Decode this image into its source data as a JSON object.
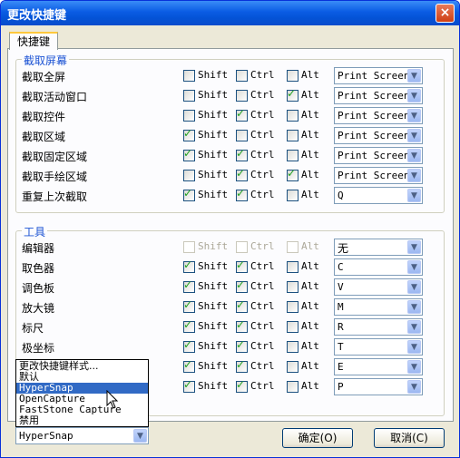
{
  "window": {
    "title": "更改快捷键",
    "close_glyph": "×"
  },
  "tab": {
    "label": "快捷键"
  },
  "capture_group": {
    "title": "截取屏幕",
    "rows": [
      {
        "label": "截取全屏",
        "shift": "Shift",
        "ctrl": "Ctrl",
        "alt": "Alt",
        "shift_checked": false,
        "ctrl_checked": false,
        "alt_checked": false,
        "value": "Print Screen"
      },
      {
        "label": "截取活动窗口",
        "shift": "Shift",
        "ctrl": "Ctrl",
        "alt": "Alt",
        "shift_checked": false,
        "ctrl_checked": false,
        "alt_checked": true,
        "value": "Print Screen"
      },
      {
        "label": "截取控件",
        "shift": "Shift",
        "ctrl": "Ctrl",
        "alt": "Alt",
        "shift_checked": false,
        "ctrl_checked": true,
        "alt_checked": false,
        "value": "Print Screen"
      },
      {
        "label": "截取区域",
        "shift": "Shift",
        "ctrl": "Ctrl",
        "alt": "Alt",
        "shift_checked": true,
        "ctrl_checked": false,
        "alt_checked": false,
        "value": "Print Screen"
      },
      {
        "label": "截取固定区域",
        "shift": "Shift",
        "ctrl": "Ctrl",
        "alt": "Alt",
        "shift_checked": true,
        "ctrl_checked": true,
        "alt_checked": false,
        "value": "Print Screen"
      },
      {
        "label": "截取手绘区域",
        "shift": "Shift",
        "ctrl": "Ctrl",
        "alt": "Alt",
        "shift_checked": false,
        "ctrl_checked": true,
        "alt_checked": true,
        "value": "Print Screen"
      },
      {
        "label": "重复上次截取",
        "shift": "Shift",
        "ctrl": "Ctrl",
        "alt": "Alt",
        "shift_checked": true,
        "ctrl_checked": true,
        "alt_checked": false,
        "value": "Q"
      }
    ]
  },
  "tools_group": {
    "title": "工具",
    "rows": [
      {
        "label": "编辑器",
        "shift": "Shift",
        "ctrl": "Ctrl",
        "alt": "Alt",
        "shift_checked": false,
        "ctrl_checked": false,
        "alt_checked": false,
        "disabled": true,
        "value": "无"
      },
      {
        "label": "取色器",
        "shift": "Shift",
        "ctrl": "Ctrl",
        "alt": "Alt",
        "shift_checked": true,
        "ctrl_checked": true,
        "alt_checked": false,
        "value": "C"
      },
      {
        "label": "调色板",
        "shift": "Shift",
        "ctrl": "Ctrl",
        "alt": "Alt",
        "shift_checked": true,
        "ctrl_checked": true,
        "alt_checked": false,
        "value": "V"
      },
      {
        "label": "放大镜",
        "shift": "Shift",
        "ctrl": "Ctrl",
        "alt": "Alt",
        "shift_checked": true,
        "ctrl_checked": true,
        "alt_checked": false,
        "value": "M"
      },
      {
        "label": "标尺",
        "shift": "Shift",
        "ctrl": "Ctrl",
        "alt": "Alt",
        "shift_checked": true,
        "ctrl_checked": true,
        "alt_checked": false,
        "value": "R"
      },
      {
        "label": "极坐标",
        "shift": "Shift",
        "ctrl": "Ctrl",
        "alt": "Alt",
        "shift_checked": true,
        "ctrl_checked": true,
        "alt_checked": false,
        "value": "T"
      },
      {
        "label": "",
        "shift": "Shift",
        "ctrl": "Ctrl",
        "alt": "Alt",
        "shift_checked": true,
        "ctrl_checked": true,
        "alt_checked": false,
        "value": "E"
      },
      {
        "label": "",
        "shift": "Shift",
        "ctrl": "Ctrl",
        "alt": "Alt",
        "shift_checked": true,
        "ctrl_checked": true,
        "alt_checked": false,
        "value": "P"
      }
    ]
  },
  "style_dropdown": {
    "selected": "HyperSnap",
    "options": [
      "更改快捷键样式...",
      "默认",
      "HyperSnap",
      "OpenCapture",
      "FastStone Capture",
      "禁用"
    ],
    "highlighted_index": 2
  },
  "buttons": {
    "ok": "确定(O)",
    "cancel": "取消(C)"
  },
  "icons": {
    "check": "✓",
    "dropdown_arrow": "▼"
  },
  "colors": {
    "title_bar": "#0a5ce4",
    "group_title": "#1c53d4",
    "check": "#21a121",
    "highlight": "#316ac5"
  }
}
